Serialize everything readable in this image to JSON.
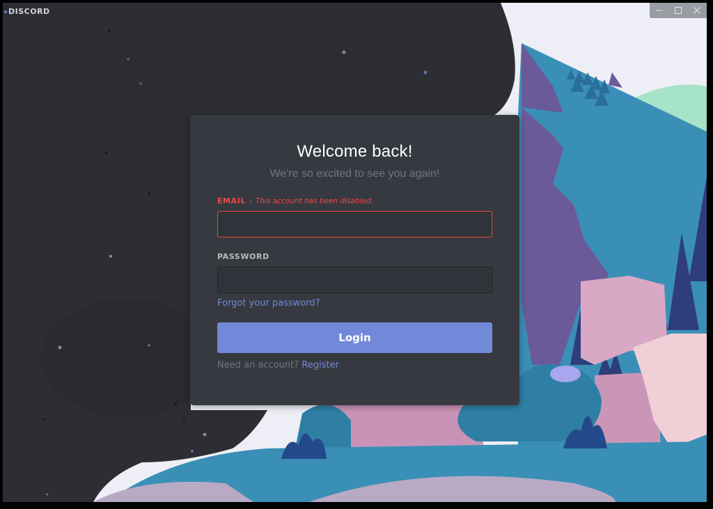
{
  "app": {
    "name": "DISCORD",
    "window_controls": [
      "minimize-icon",
      "maximize-icon",
      "close-icon"
    ]
  },
  "login": {
    "title": "Welcome back!",
    "subtitle": "We're so excited to see you again!",
    "email": {
      "label": "EMAIL",
      "separator": "-",
      "error": "This account has been disabled.",
      "value": "",
      "placeholder": ""
    },
    "password": {
      "label": "PASSWORD",
      "value": "",
      "placeholder": ""
    },
    "forgot_link": "Forgot your password?",
    "login_button": "Login",
    "register_prompt": "Need an account?",
    "register_link": "Register"
  },
  "colors": {
    "accent": "#7289da",
    "error": "#f04747",
    "card_bg": "#36393f",
    "background_dark": "#2c2e33"
  }
}
